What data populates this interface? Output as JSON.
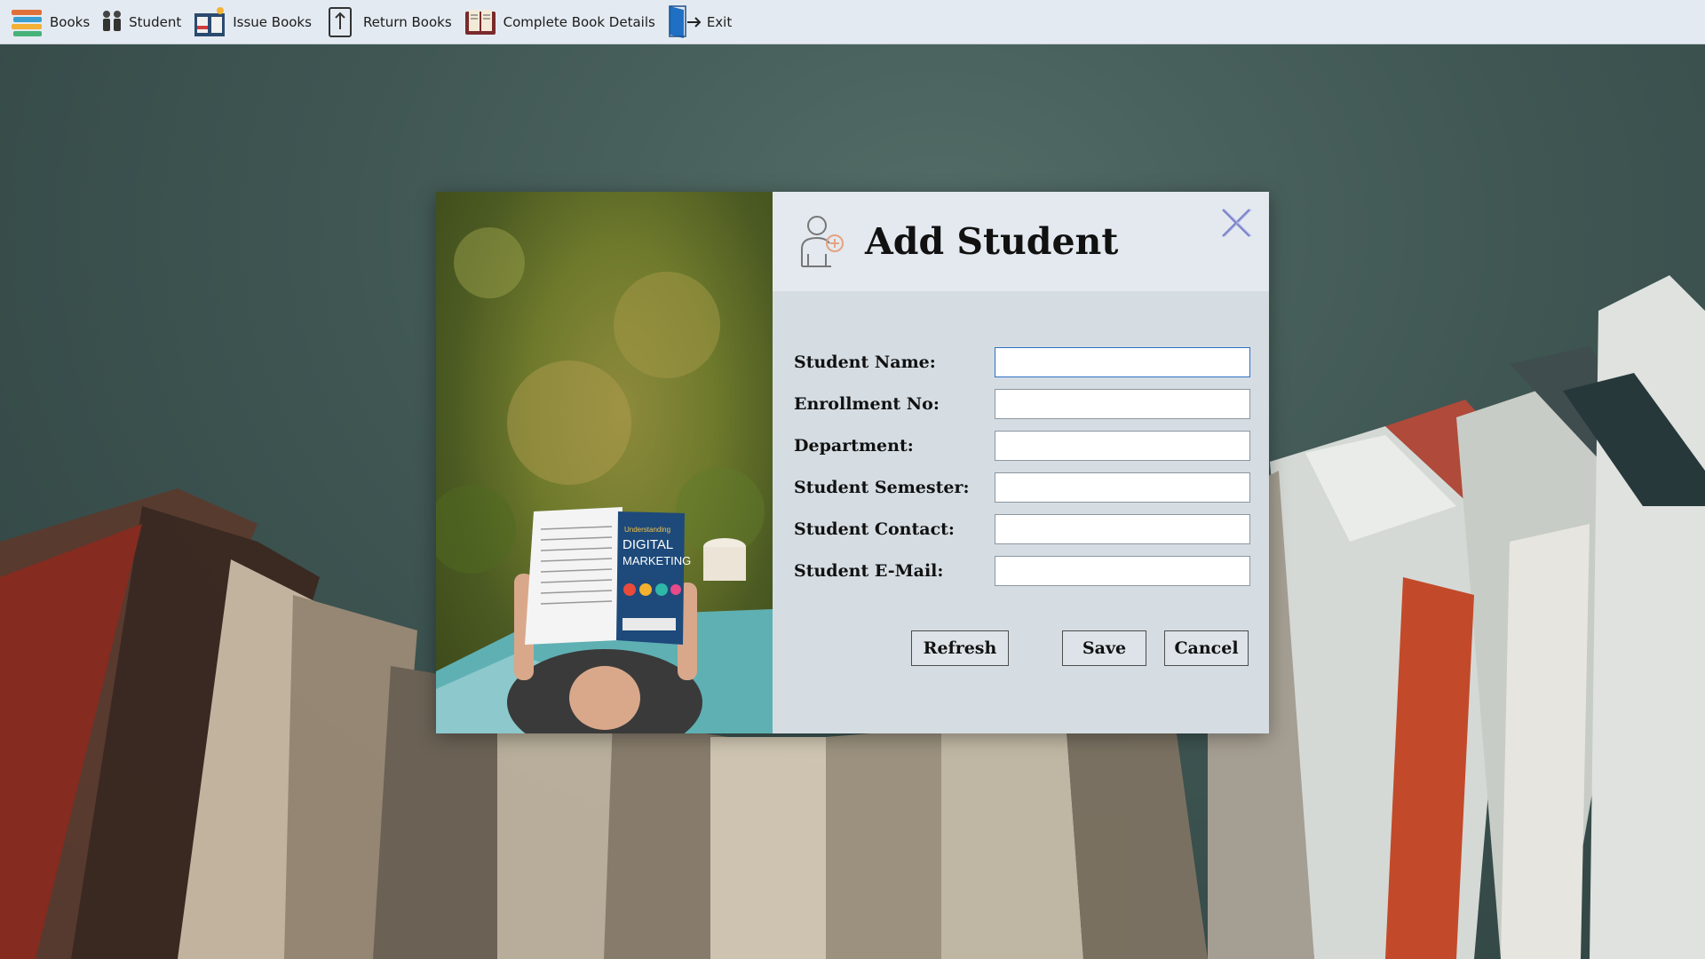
{
  "toolbar": {
    "items": [
      {
        "label": "Books",
        "icon": "books-stack-icon"
      },
      {
        "label": "Student",
        "icon": "students-icon"
      },
      {
        "label": "Issue Books",
        "icon": "issue-books-icon"
      },
      {
        "label": "Return Books",
        "icon": "return-books-icon"
      },
      {
        "label": "Complete Book Details",
        "icon": "book-details-icon"
      },
      {
        "label": "Exit",
        "icon": "exit-door-icon"
      }
    ]
  },
  "dialog": {
    "title": "Add Student",
    "header_icon": "add-user-icon",
    "close_icon": "close-icon",
    "fields": [
      {
        "label": "Student Name:",
        "value": "",
        "focused": true
      },
      {
        "label": "Enrollment No:",
        "value": ""
      },
      {
        "label": "Department:",
        "value": ""
      },
      {
        "label": "Student Semester:",
        "value": ""
      },
      {
        "label": "Student Contact:",
        "value": ""
      },
      {
        "label": "Student E-Mail:",
        "value": ""
      }
    ],
    "buttons": {
      "refresh": "Refresh",
      "save": "Save",
      "cancel": "Cancel"
    }
  },
  "photo": {
    "book_title_line1": "Understanding",
    "book_title_line2": "DIGITAL",
    "book_title_line3": "MARKETING"
  },
  "colors": {
    "toolbar_bg": "#e4eaf1",
    "panel_bg": "#d5dde3",
    "header_bg": "#e3e9ef",
    "focus_border": "#2e6fc5"
  }
}
